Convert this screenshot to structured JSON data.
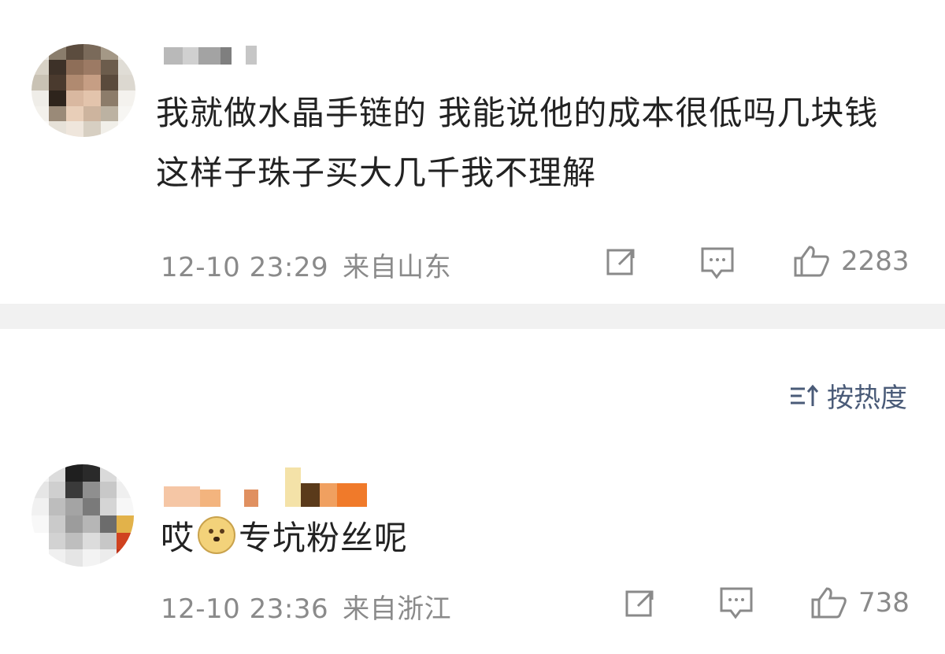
{
  "comments": [
    {
      "text": "我就做水晶手链的 我能说他的成本很低吗几块钱这样子珠子买大几千我不理解",
      "time": "12-10 23:29",
      "location": "来自山东",
      "likes": "2283",
      "icons": {
        "forward": "share-icon",
        "comment": "comment-icon",
        "like": "thumbs-up-icon"
      }
    },
    {
      "text_before": "哎",
      "emoji": "doge-emoji",
      "text_after": "专坑粉丝呢",
      "time": "12-10 23:36",
      "location": "来自浙江",
      "likes": "738",
      "icons": {
        "forward": "share-icon",
        "comment": "comment-icon",
        "like": "thumbs-up-icon"
      }
    }
  ],
  "sort": {
    "label": "按热度",
    "icon": "sort-icon",
    "color": "#4a5b78"
  },
  "colors": {
    "text": "#222222",
    "meta": "#8a8a8a",
    "separator": "#f1f1f1"
  }
}
